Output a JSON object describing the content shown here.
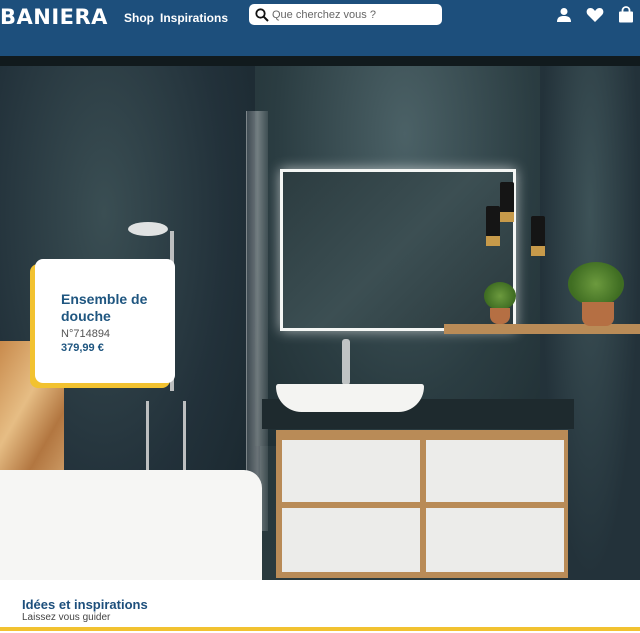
{
  "brand": {
    "logo": "BANIERA"
  },
  "nav": {
    "shop": "Shop",
    "inspirations": "Inspirations"
  },
  "search": {
    "placeholder": "Que cherchez vous ?"
  },
  "header_icons": [
    "user-icon",
    "heart-icon",
    "cart-icon"
  ],
  "product": {
    "title": "Ensemble de douche",
    "reference": "N°714894",
    "price": "379,99 €"
  },
  "section": {
    "title": "Idées et inspirations",
    "subtitle": "Laissez vous guider"
  },
  "colors": {
    "header_bg": "#1d4f7c",
    "accent": "#f2c230",
    "primary_text": "#1f5680"
  }
}
